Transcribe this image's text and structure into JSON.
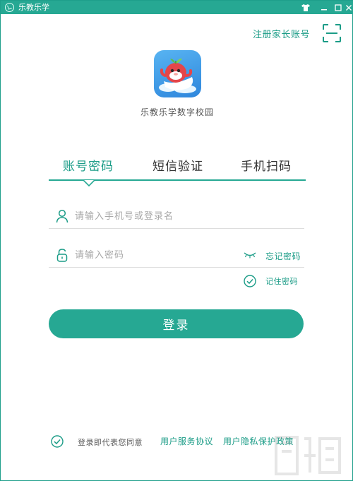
{
  "window": {
    "title": "乐教乐学"
  },
  "header": {
    "register_link": "注册家长账号",
    "qr_icon": "qr-scan-icon"
  },
  "logo": {
    "name": "乐教乐学数字校园"
  },
  "tabs": [
    {
      "label": "账号密码",
      "active": true
    },
    {
      "label": "短信验证",
      "active": false
    },
    {
      "label": "手机扫码",
      "active": false
    }
  ],
  "form": {
    "username_placeholder": "请输入手机号或登录名",
    "password_placeholder": "请输入密码",
    "forgot_label": "忘记密码",
    "remember_label": "记住密码",
    "remember_checked": true,
    "login_label": "登录"
  },
  "agreement": {
    "prefix": "登录即代表您同意",
    "service_link": "用户服务协议",
    "privacy_link": "用户隐私保护政策",
    "checked": true
  },
  "colors": {
    "accent": "#26a893",
    "accent_text": "#1b9c87",
    "logo_bg": "#3d96e6"
  }
}
